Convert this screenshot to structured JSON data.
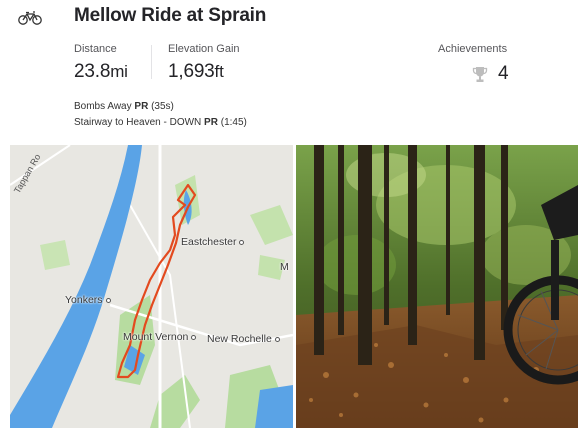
{
  "activity": {
    "type_icon": "bike-icon",
    "title": "Mellow Ride at Sprain"
  },
  "stats": {
    "distance": {
      "label": "Distance",
      "value": "23.8",
      "unit": "mi"
    },
    "elevation": {
      "label": "Elevation Gain",
      "value": "1,693",
      "unit": "ft"
    },
    "achievements": {
      "label": "Achievements",
      "icon": "trophy-icon",
      "count": "4"
    }
  },
  "segments": [
    {
      "name": "Bombs Away",
      "badge": "PR",
      "time": "(35s)"
    },
    {
      "name": "Stairway to Heaven - DOWN",
      "badge": "PR",
      "time": "(1:45)"
    }
  ],
  "map": {
    "labels": {
      "eastchester": "Eastchester",
      "yonkers": "Yonkers",
      "mount_vernon": "Mount Vernon",
      "new_rochelle": "New Rochelle",
      "edge": "M",
      "tappan": "Tappan Ro"
    },
    "colors": {
      "water": "#5aa3e6",
      "park": "#b7dca0",
      "route": "#e34a1f",
      "land": "#e8e7e2"
    }
  },
  "photo": {
    "icon": "forest-photo"
  }
}
